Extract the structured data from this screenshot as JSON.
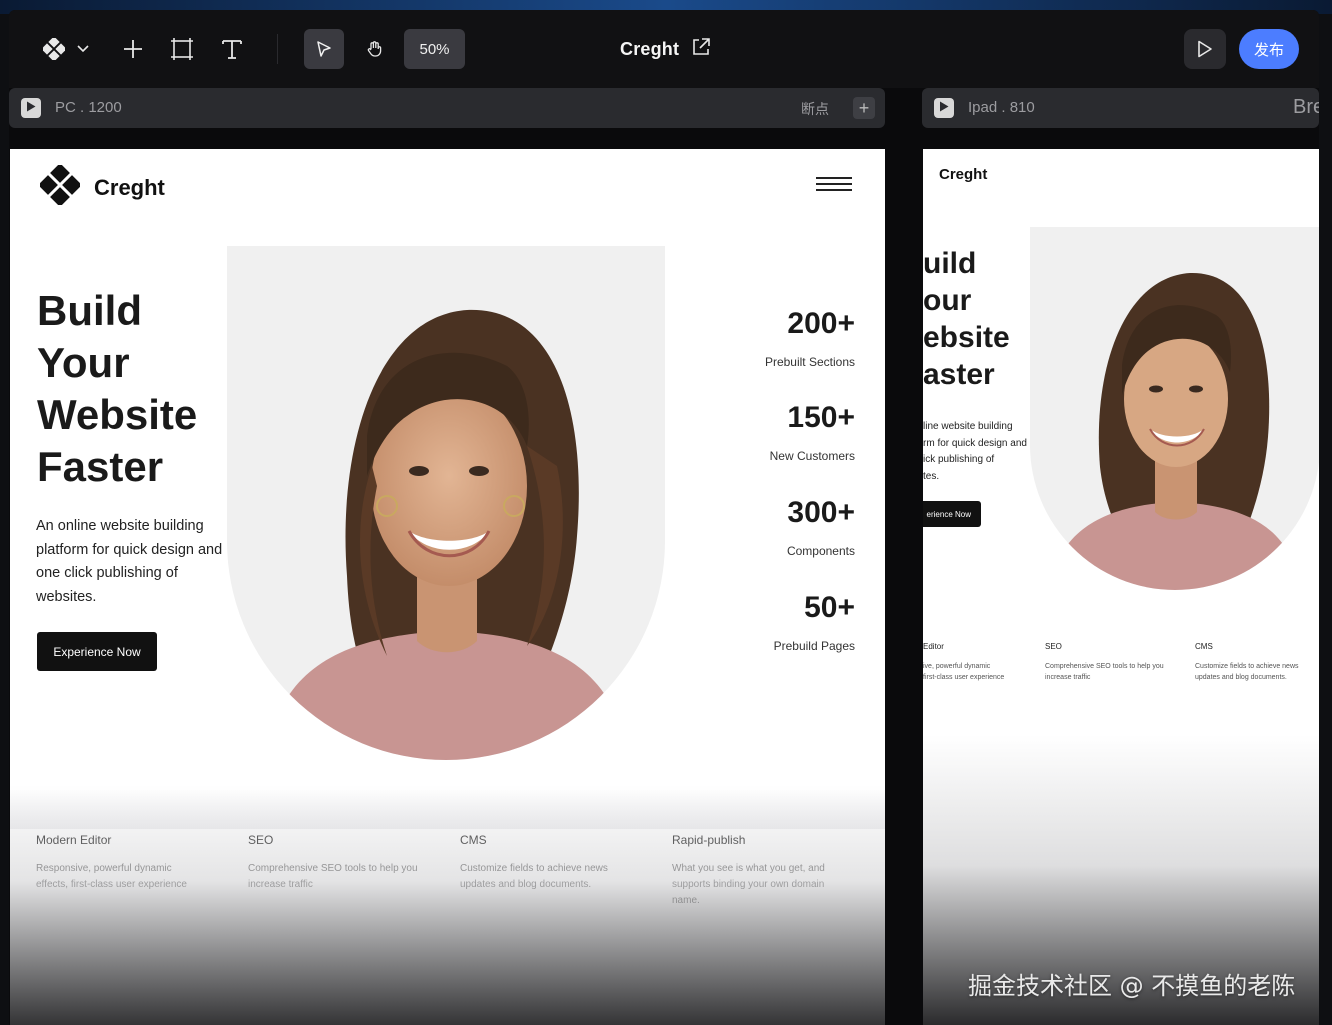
{
  "toolbar": {
    "zoom": "50%",
    "project_title": "Creght",
    "publish_label": "发布"
  },
  "breakpoints": {
    "pc_label": "PC . 1200",
    "breakpoint_label": "断点",
    "add_symbol": "+",
    "ipad_label": "Ipad . 810",
    "next_label_partial": "Bre"
  },
  "pc": {
    "brand": "Creght",
    "hero_title_lines": [
      "Build",
      "Your",
      "Website",
      "Faster"
    ],
    "hero_desc_lines": [
      "An online website building",
      "platform for quick design and",
      "one click publishing of",
      "websites."
    ],
    "cta_label": "Experience Now",
    "stats": [
      {
        "num": "200+",
        "label": "Prebuilt Sections"
      },
      {
        "num": "150+",
        "label": "New Customers"
      },
      {
        "num": "300+",
        "label": "Components"
      },
      {
        "num": "50+",
        "label": "Prebuild Pages"
      }
    ],
    "features": [
      {
        "title": "Modern Editor",
        "desc_lines": [
          "Responsive, powerful dynamic",
          "effects, first-class user experience"
        ]
      },
      {
        "title": "SEO",
        "desc_lines": [
          "Comprehensive SEO tools to help you",
          "increase traffic"
        ]
      },
      {
        "title": "CMS",
        "desc_lines": [
          "Customize fields to achieve news",
          "updates and blog documents."
        ]
      },
      {
        "title": "Rapid-publish",
        "desc_lines": [
          "What you see is what you get, and",
          "supports binding your own domain",
          "name."
        ]
      }
    ]
  },
  "ipad": {
    "brand": "Creght",
    "hero_title_lines": [
      "uild",
      "our",
      "ebsite",
      "aster"
    ],
    "hero_desc_lines": [
      "line website building",
      "rm for quick design and",
      "ick publishing of",
      "tes."
    ],
    "cta_label": "erience Now",
    "features": [
      {
        "title": "Editor",
        "desc_lines": [
          "ive, powerful dynamic",
          "first-class user experience"
        ]
      },
      {
        "title": "SEO",
        "desc_lines": [
          "Comprehensive SEO tools to help you",
          "increase traffic"
        ]
      },
      {
        "title": "CMS",
        "desc_lines": [
          "Customize fields to achieve news",
          "updates and blog documents."
        ]
      }
    ]
  },
  "watermark": "掘金技术社区 @ 不摸鱼的老陈",
  "colors": {
    "accent": "#4c7dff",
    "toolbar_bg": "#111113",
    "active_tool_bg": "#3a3a40",
    "cta_bg": "#111111"
  },
  "icons": [
    "logo-diamond-icon",
    "chevron-down-icon",
    "plus-icon",
    "frame-icon",
    "text-icon",
    "cursor-icon",
    "hand-icon",
    "external-link-icon",
    "play-icon",
    "hamburger-menu-icon"
  ]
}
